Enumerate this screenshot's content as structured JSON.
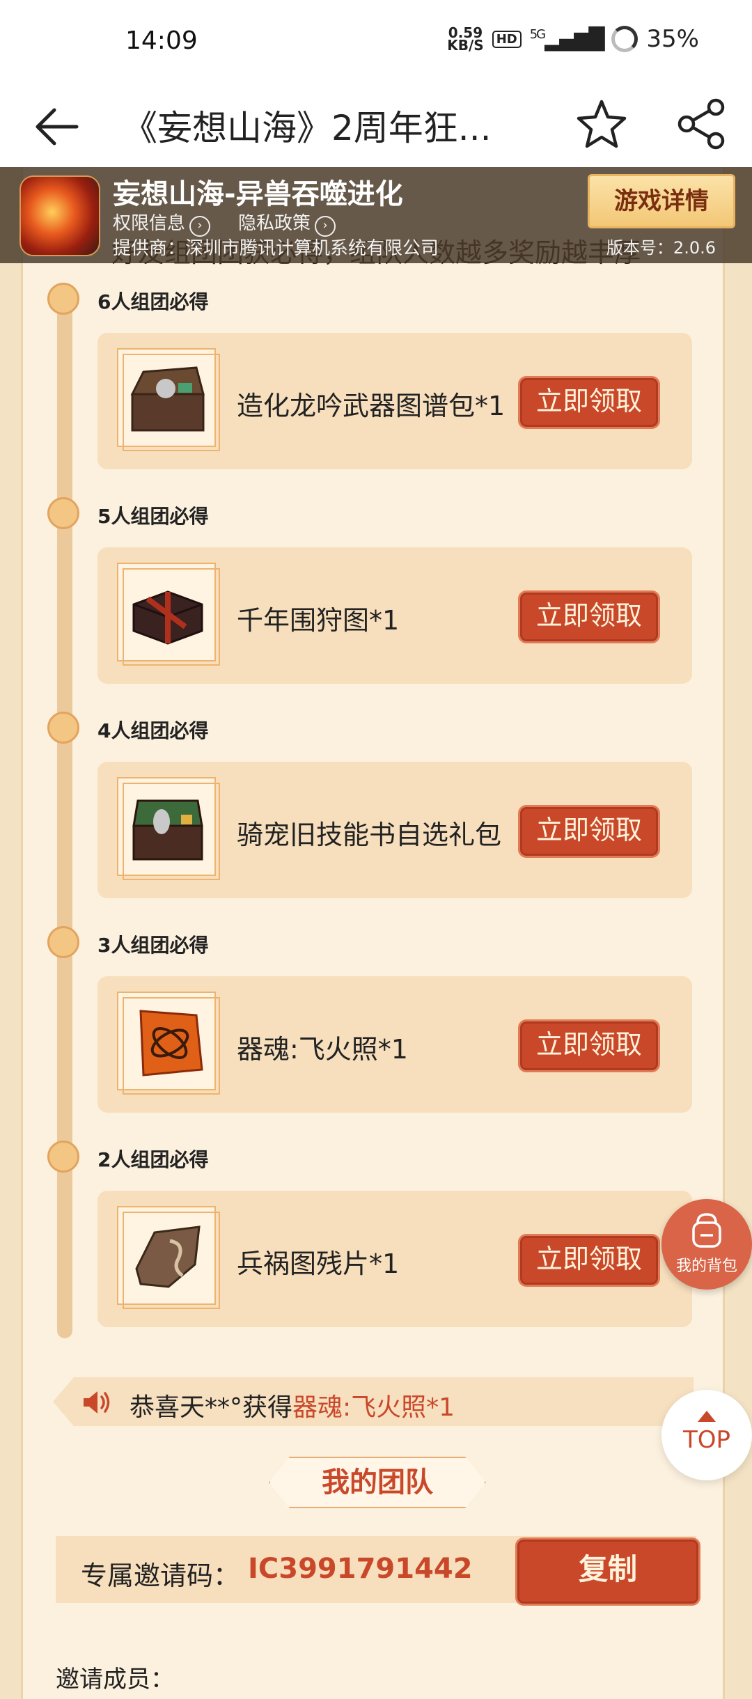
{
  "status_bar": {
    "time": "14:09",
    "net_speed_value": "0.59",
    "net_speed_unit": "KB/S",
    "hd": "HD",
    "network": "5G",
    "battery": "35%"
  },
  "header": {
    "title": "《妄想山海》2周年狂..."
  },
  "banner": {
    "game_name": "妄想山海-异兽吞噬进化",
    "permissions": "权限信息",
    "privacy": "隐私政策",
    "provider": "提供商：深圳市腾讯计算机系统有限公司",
    "detail_button": "游戏详情",
    "version": "版本号：2.0.6"
  },
  "intro_text": "好友组团团获必得，组队人数越多奖励越丰厚",
  "tiers": [
    {
      "label": "6人组团必得",
      "item": "造化龙吟武器图谱包*1",
      "button": "立即领取"
    },
    {
      "label": "5人组团必得",
      "item": "千年围狩图*1",
      "button": "立即领取"
    },
    {
      "label": "4人组团必得",
      "item": "骑宠旧技能书自选礼包*1",
      "button": "立即领取"
    },
    {
      "label": "3人组团必得",
      "item": "器魂:飞火照*1",
      "button": "立即领取"
    },
    {
      "label": "2人组团必得",
      "item": "兵祸图残片*1",
      "button": "立即领取"
    }
  ],
  "floating": {
    "bag_label": "我的背包",
    "top_label": "TOP"
  },
  "notice": {
    "prefix": "恭喜天**°获得",
    "highlight": "器魂:飞火照*1"
  },
  "team": {
    "title": "我的团队",
    "invite_label": "专属邀请码：",
    "invite_code": "IC3991791442",
    "copy_button": "复制",
    "members_label": "邀请成员："
  }
}
